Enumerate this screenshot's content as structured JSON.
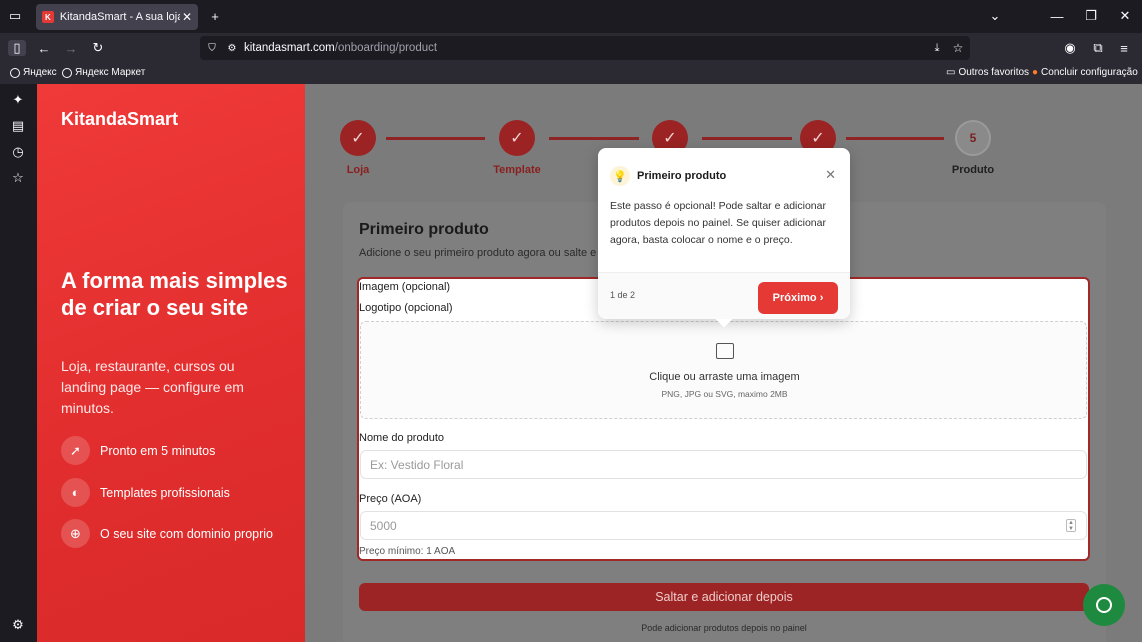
{
  "browser": {
    "tab_title": "KitandaSmart - A sua loja online",
    "tab_favicon": "K",
    "url_host": "kitandasmart.com",
    "url_path": "/onboarding/product",
    "bookmarks": [
      "Яндекс",
      "Яндекс Маркет"
    ],
    "bookmarks_right": [
      "Outros favoritos",
      "Concluir configuração"
    ]
  },
  "brand": "KitandaSmart",
  "hero": {
    "title": "A forma mais simples de criar o seu site",
    "subtitle": "Loja, restaurante, cursos ou landing page — configure em minutos."
  },
  "features": [
    {
      "icon": "rocket-icon",
      "label": "Pronto em 5 minutos"
    },
    {
      "icon": "palette-icon",
      "label": "Templates profissionais"
    },
    {
      "icon": "globe-icon",
      "label": "O seu site com dominio proprio"
    }
  ],
  "steps": [
    {
      "label": "Loja",
      "done": true
    },
    {
      "label": "Template",
      "done": true
    },
    {
      "label": "",
      "done": true
    },
    {
      "label": "",
      "done": true
    },
    {
      "label": "Produto",
      "number": "5",
      "done": false
    }
  ],
  "form": {
    "title": "Primeiro produto",
    "description": "Adicione o seu primeiro produto agora ou salte e",
    "image_label": "Imagem (opcional)",
    "logo_label": "Logotipo (opcional)",
    "dropzone_text": "Clique ou arraste uma imagem",
    "dropzone_hint": "PNG, JPG ou SVG, maximo 2MB",
    "name_label": "Nome do produto",
    "name_placeholder": "Ex: Vestido Floral",
    "price_label": "Preço (AOA)",
    "price_placeholder": "5000",
    "price_hint": "Preço mínimo: 1 AOA",
    "skip_button": "Saltar e adicionar depois",
    "skip_note": "Pode adicionar produtos depois no painel"
  },
  "popover": {
    "title": "Primeiro produto",
    "body": "Este passo é opcional! Pode saltar e adicionar produtos depois no painel. Se quiser adicionar agora, basta colocar o nome e o preço.",
    "counter": "1 de 2",
    "next_button": "Próximo"
  },
  "colors": {
    "brand": "#e53935",
    "chat": "#1e8a3f"
  }
}
